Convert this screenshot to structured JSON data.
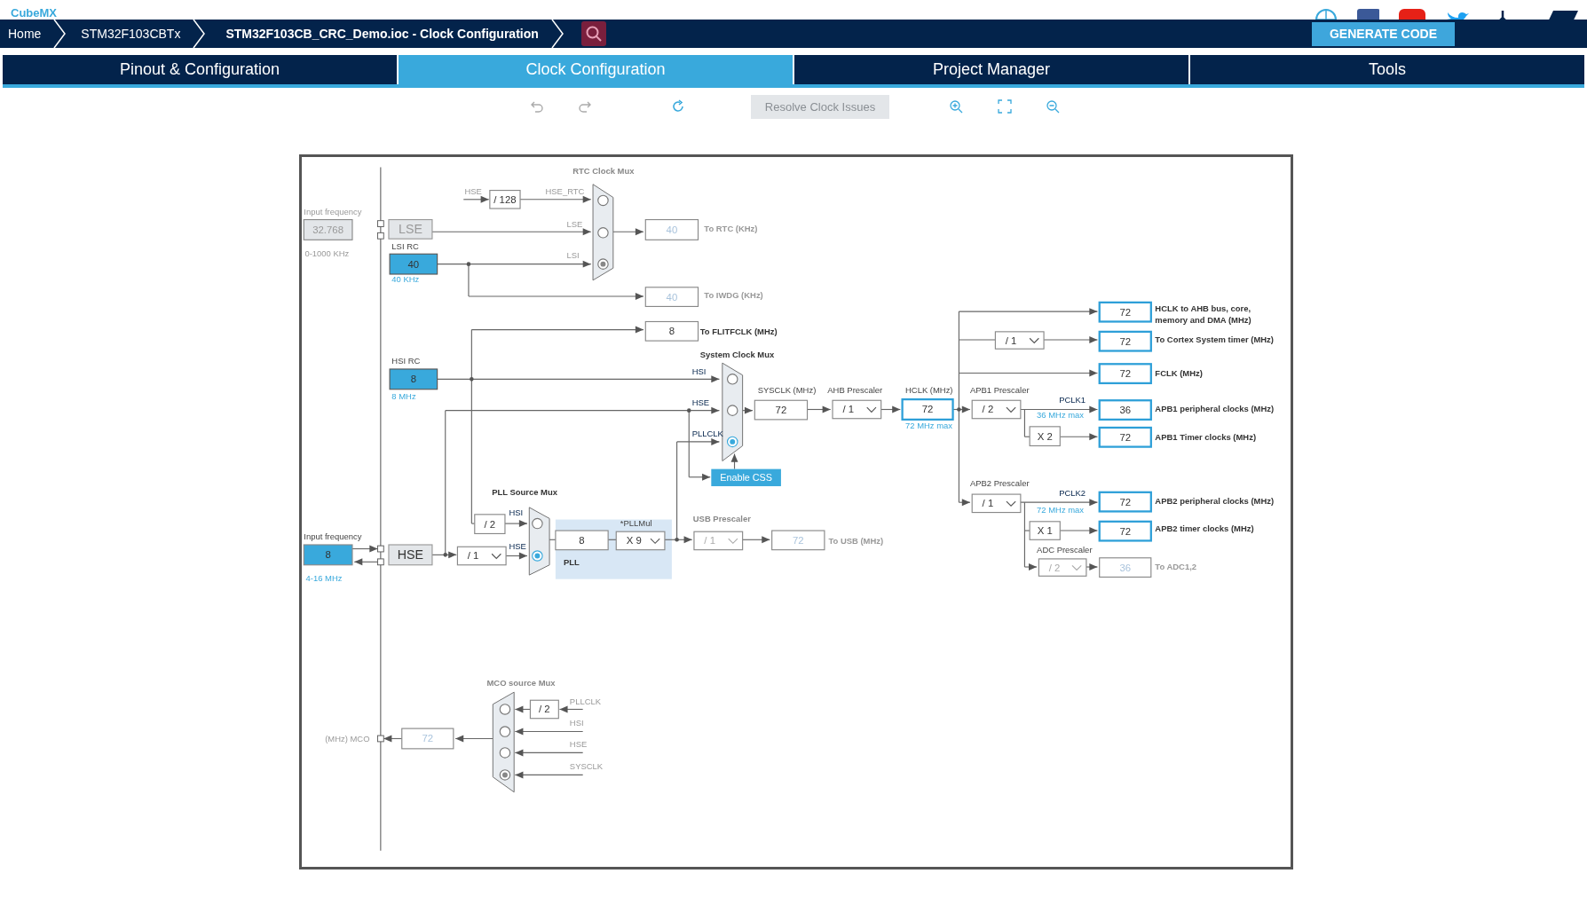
{
  "app": {
    "logo": "CubeMX"
  },
  "breadcrumbs": [
    {
      "label": "Home",
      "current": false
    },
    {
      "label": "STM32F103CBTx",
      "current": false
    },
    {
      "label": "STM32F103CB_CRC_Demo.ioc - Clock Configuration",
      "current": true
    }
  ],
  "generate_button": {
    "label": "GENERATE CODE"
  },
  "tabs": [
    {
      "label": "Pinout & Configuration",
      "selected": false
    },
    {
      "label": "Clock Configuration",
      "selected": true
    },
    {
      "label": "Project Manager",
      "selected": false
    },
    {
      "label": "Tools",
      "selected": false
    }
  ],
  "toolbar": {
    "resolve_button": {
      "label": "Resolve Clock Issues",
      "disabled": true
    }
  },
  "diagram": {
    "labels": [
      {
        "text": "RTC Clock Mux",
        "kind": "muted_title"
      },
      {
        "text": "Input frequency",
        "kind": "hint"
      },
      {
        "text": "0-1000 KHz",
        "kind": "hint"
      },
      {
        "text": "LSI RC",
        "kind": "caption"
      },
      {
        "text": "40 KHz",
        "kind": "note"
      },
      {
        "text": "HSE",
        "kind": "hint"
      },
      {
        "text": "To RTC (KHz)",
        "kind": "output_off"
      },
      {
        "text": "To IWDG (KHz)",
        "kind": "output_off"
      },
      {
        "text": "To FLITFCLK (MHz)",
        "kind": "output"
      },
      {
        "text": "System Clock Mux",
        "kind": "title"
      },
      {
        "text": "HSI RC",
        "kind": "caption"
      },
      {
        "text": "8 MHz",
        "kind": "note"
      },
      {
        "text": "SYSCLK (MHz)",
        "kind": "caption"
      },
      {
        "text": "AHB Prescaler",
        "kind": "caption"
      },
      {
        "text": "HCLK (MHz)",
        "kind": "caption"
      },
      {
        "text": "72 MHz max",
        "kind": "note"
      },
      {
        "text": "APB1 Prescaler",
        "kind": "caption"
      },
      {
        "text": "PCLK1",
        "kind": "signal"
      },
      {
        "text": "36 MHz max",
        "kind": "note"
      },
      {
        "text": "HCLK to AHB bus, core,",
        "kind": "output"
      },
      {
        "text": "memory and DMA (MHz)",
        "kind": "output"
      },
      {
        "text": "To Cortex System timer (MHz)",
        "kind": "output"
      },
      {
        "text": "FCLK (MHz)",
        "kind": "output"
      },
      {
        "text": "APB1 peripheral clocks (MHz)",
        "kind": "output"
      },
      {
        "text": "APB1 Timer clocks (MHz)",
        "kind": "output"
      },
      {
        "text": "APB2 Prescaler",
        "kind": "caption"
      },
      {
        "text": "PCLK2",
        "kind": "signal"
      },
      {
        "text": "72 MHz max",
        "kind": "note"
      },
      {
        "text": "APB2 peripheral clocks (MHz)",
        "kind": "output"
      },
      {
        "text": "APB2 timer clocks (MHz)",
        "kind": "output"
      },
      {
        "text": "ADC Prescaler",
        "kind": "caption"
      },
      {
        "text": "To ADC1,2",
        "kind": "output_off"
      },
      {
        "text": "PLL Source Mux",
        "kind": "title"
      },
      {
        "text": "*PLLMul",
        "kind": "caption"
      },
      {
        "text": "PLL",
        "kind": "title"
      },
      {
        "text": "USB Prescaler",
        "kind": "muted_title"
      },
      {
        "text": "To USB (MHz)",
        "kind": "output_off"
      },
      {
        "text": "Input frequency",
        "kind": "caption"
      },
      {
        "text": "4-16 MHz",
        "kind": "note"
      },
      {
        "text": "MCO source Mux",
        "kind": "muted_title"
      },
      {
        "text": "(MHz) MCO",
        "kind": "hint"
      }
    ],
    "fields": [
      {
        "value": "32.768",
        "kind": "input",
        "disabled": true
      },
      {
        "value": "LSE",
        "kind": "source",
        "disabled": true
      },
      {
        "value": "40",
        "kind": "oscillator",
        "disabled": false
      },
      {
        "value": "/ 128",
        "kind": "block",
        "disabled": false
      },
      {
        "value": "40",
        "kind": "block",
        "disabled": true
      },
      {
        "value": "40",
        "kind": "block",
        "disabled": true
      },
      {
        "value": "8",
        "kind": "block",
        "disabled": false
      },
      {
        "value": "8",
        "kind": "oscillator",
        "disabled": false
      },
      {
        "value": "72",
        "kind": "block",
        "disabled": false
      },
      {
        "value": "72",
        "kind": "output",
        "disabled": false
      },
      {
        "value": "72",
        "kind": "output",
        "disabled": false
      },
      {
        "value": "72",
        "kind": "output",
        "disabled": false
      },
      {
        "value": "72",
        "kind": "output",
        "disabled": false
      },
      {
        "value": "36",
        "kind": "output",
        "disabled": false
      },
      {
        "value": "72",
        "kind": "output",
        "disabled": false
      },
      {
        "value": "72",
        "kind": "output",
        "disabled": false
      },
      {
        "value": "72",
        "kind": "output",
        "disabled": false
      },
      {
        "value": "36",
        "kind": "block",
        "disabled": true
      },
      {
        "value": "X 2",
        "kind": "block",
        "disabled": false
      },
      {
        "value": "X 1",
        "kind": "block",
        "disabled": false
      },
      {
        "value": "8",
        "kind": "input",
        "disabled": false
      },
      {
        "value": "HSE",
        "kind": "source",
        "disabled": false
      },
      {
        "value": "/ 2",
        "kind": "block",
        "disabled": false
      },
      {
        "value": "8",
        "kind": "block",
        "disabled": false
      },
      {
        "value": "72",
        "kind": "block",
        "disabled": true
      },
      {
        "value": "72",
        "kind": "block",
        "disabled": true
      },
      {
        "value": "/ 2",
        "kind": "block",
        "disabled": false
      }
    ],
    "dropdowns": [
      {
        "value": "/ 1",
        "disabled": false
      },
      {
        "value": "X 9",
        "disabled": false
      },
      {
        "value": "/ 1",
        "disabled": true
      },
      {
        "value": "/ 1",
        "disabled": false
      },
      {
        "value": "/ 1",
        "disabled": false
      },
      {
        "value": "/ 2",
        "disabled": false
      },
      {
        "value": "/ 1",
        "disabled": false
      },
      {
        "value": "/ 2",
        "disabled": true
      }
    ],
    "muxes": [
      {
        "enabled": false,
        "options": [
          {
            "label": "HSE_RTC",
            "selected": false
          },
          {
            "label": "LSE",
            "selected": false
          },
          {
            "label": "LSI",
            "selected": true
          }
        ]
      },
      {
        "enabled": true,
        "options": [
          {
            "label": "HSI",
            "selected": false
          },
          {
            "label": "HSE",
            "selected": false
          },
          {
            "label": "PLLCLK",
            "selected": true
          }
        ]
      },
      {
        "enabled": true,
        "options": [
          {
            "label": "HSI",
            "selected": false
          },
          {
            "label": "HSE",
            "selected": true
          }
        ]
      },
      {
        "enabled": false,
        "options": [
          {
            "label": "PLLCLK",
            "selected": false
          },
          {
            "label": "HSI",
            "selected": false
          },
          {
            "label": "HSE",
            "selected": false
          },
          {
            "label": "SYSCLK",
            "selected": true
          }
        ]
      }
    ],
    "css_button": {
      "label": "Enable CSS"
    }
  }
}
